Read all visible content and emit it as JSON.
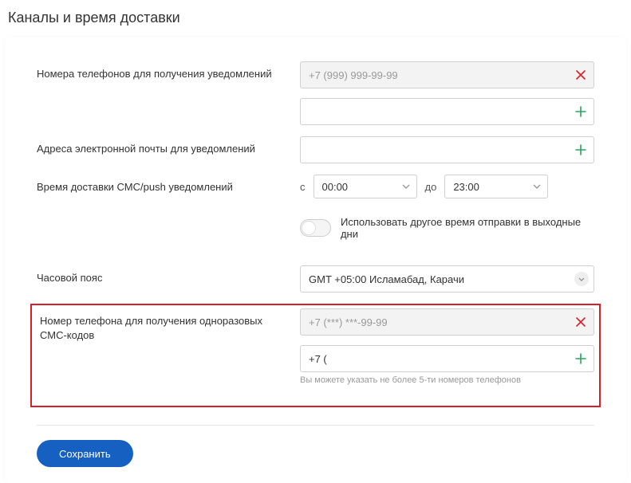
{
  "pageTitle": "Каналы и время доставки",
  "phones": {
    "label": "Номера телефонов для получения уведомлений",
    "masked": "+7 (999) 999-99-99",
    "addValue": ""
  },
  "emails": {
    "label": "Адреса электронной почты для уведомлений",
    "addValue": ""
  },
  "timing": {
    "label": "Время доставки СМС/push уведомлений",
    "fromLabel": "с",
    "from": "00:00",
    "toLabel": "до",
    "to": "23:00"
  },
  "weekend": {
    "label": "Использовать другое время отправки в выходные дни",
    "enabled": false
  },
  "timezone": {
    "label": "Часовой пояс",
    "value": "GMT +05:00 Исламабад, Карачи"
  },
  "smsCodes": {
    "label": "Номер телефона для получения одноразовых СМС-кодов",
    "masked": "+7 (***) ***-99-99",
    "addValue": "+7 (",
    "hint": "Вы можете указать не более 5-ти номеров телефонов"
  },
  "saveLabel": "Сохранить"
}
